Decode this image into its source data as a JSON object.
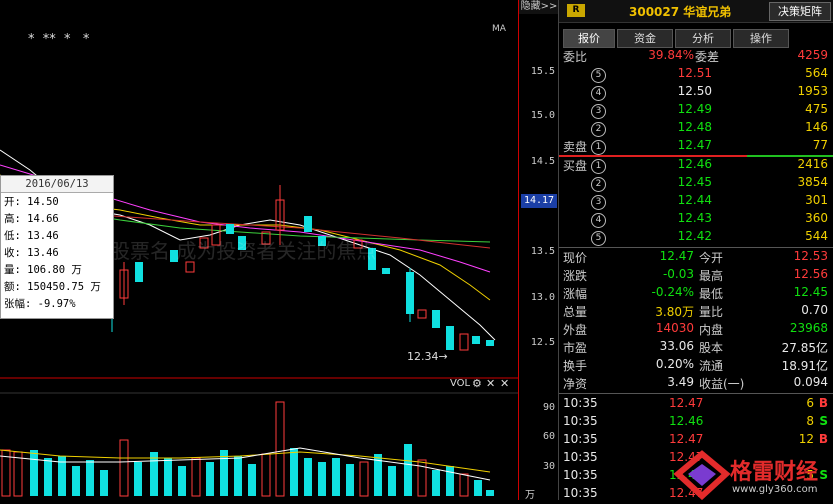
{
  "chart": {
    "toolbar": {
      "hide_label": "隐藏>>"
    },
    "ma_label": "MA",
    "markers": "*  **  *   *",
    "price_ticks": [
      "15.5",
      "15.0",
      "14.5",
      "14.0",
      "13.5",
      "13.0",
      "12.5"
    ],
    "current_price": "14.17",
    "low_label": "12.34→",
    "vol_label": "VOL",
    "vol_ticks": [
      "90",
      "60",
      "30"
    ],
    "vol_unit": "万",
    "watermark": "股票名                      成为投资者关注的焦点"
  },
  "tooltip": {
    "date": "2016/06/13",
    "rows": [
      "开: 14.50",
      "高: 14.66",
      "低: 13.46",
      "收: 13.46",
      "量: 106.80 万",
      "额: 150450.75 万",
      "张幅: -9.97%"
    ]
  },
  "panel": {
    "badge": "R",
    "stock": "300027 华谊兄弟",
    "decision_button": "决策矩阵",
    "tabs": [
      "报价",
      "资金",
      "分析",
      "操作"
    ],
    "ratio": {
      "label": "委比",
      "value": "39.84%",
      "label2": "委差",
      "value2": "4259"
    },
    "sell": [
      {
        "n": "5",
        "price": "12.51",
        "vol": "564",
        "c": "red"
      },
      {
        "n": "4",
        "price": "12.50",
        "vol": "1953",
        "c": "white"
      },
      {
        "n": "3",
        "price": "12.49",
        "vol": "475",
        "c": "green"
      },
      {
        "n": "2",
        "price": "12.48",
        "vol": "146",
        "c": "green"
      },
      {
        "n": "1",
        "price": "12.47",
        "vol": "77",
        "c": "green",
        "lab": "卖盘"
      }
    ],
    "buy": [
      {
        "n": "1",
        "price": "12.46",
        "vol": "2416",
        "c": "green",
        "lab": "买盘"
      },
      {
        "n": "2",
        "price": "12.45",
        "vol": "3854",
        "c": "green"
      },
      {
        "n": "3",
        "price": "12.44",
        "vol": "301",
        "c": "green"
      },
      {
        "n": "4",
        "price": "12.43",
        "vol": "360",
        "c": "green"
      },
      {
        "n": "5",
        "price": "12.42",
        "vol": "544",
        "c": "green"
      }
    ],
    "stats": [
      {
        "l1": "现价",
        "v1": "12.47",
        "c1": "green",
        "l2": "今开",
        "v2": "12.53",
        "c2": "red"
      },
      {
        "l1": "涨跌",
        "v1": "-0.03",
        "c1": "green",
        "l2": "最高",
        "v2": "12.56",
        "c2": "red"
      },
      {
        "l1": "涨幅",
        "v1": "-0.24%",
        "c1": "green",
        "l2": "最低",
        "v2": "12.45",
        "c2": "green"
      },
      {
        "l1": "总量",
        "v1": "3.80万",
        "c1": "yellow",
        "l2": "量比",
        "v2": "0.70",
        "c2": "white"
      },
      {
        "l1": "外盘",
        "v1": "14030",
        "c1": "red",
        "l2": "内盘",
        "v2": "23968",
        "c2": "green"
      },
      {
        "l1": "市盈",
        "v1": "33.06",
        "c1": "white",
        "l2": "股本",
        "v2": "27.85亿",
        "c2": "white"
      },
      {
        "l1": "换手",
        "v1": "0.20%",
        "c1": "white",
        "l2": "流通",
        "v2": "18.91亿",
        "c2": "white"
      },
      {
        "l1": "净资",
        "v1": "3.49",
        "c1": "white",
        "l2": "收益(一)",
        "v2": "0.094",
        "c2": "white"
      }
    ],
    "ticks": [
      {
        "t": "10:35",
        "p": "12.47",
        "q": "6",
        "d": "B",
        "c": "red"
      },
      {
        "t": "10:35",
        "p": "12.46",
        "q": "8",
        "d": "S",
        "c": "green"
      },
      {
        "t": "10:35",
        "p": "12.47",
        "q": "12",
        "d": "B",
        "c": "red"
      },
      {
        "t": "10:35",
        "p": "12.47",
        "q": "",
        "d": "",
        "c": "red"
      },
      {
        "t": "10:35",
        "p": "12.47",
        "q": "5",
        "d": "S",
        "c": "green"
      },
      {
        "t": "10:35",
        "p": "12.47",
        "q": "",
        "d": "",
        "c": "red"
      }
    ]
  },
  "brand": {
    "name": "格雷财经",
    "url": "www.gly360.com"
  },
  "colors": {
    "up": "#ff3b3b",
    "down": "#10e0e0",
    "accent": "#f0d000"
  }
}
